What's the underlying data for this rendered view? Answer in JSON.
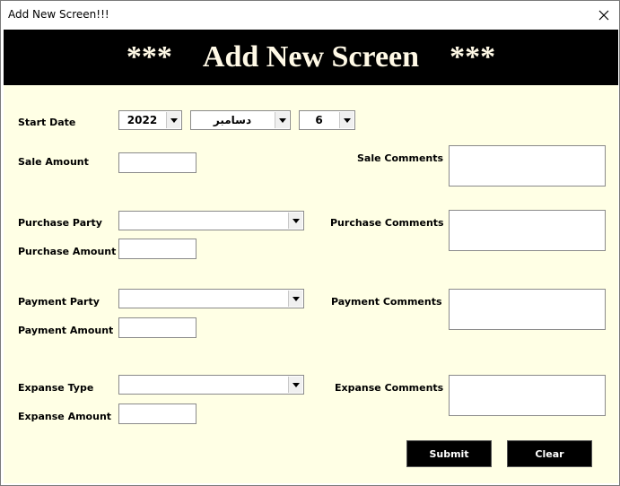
{
  "window": {
    "title": "Add New Screen!!!"
  },
  "banner": {
    "left_stars": "***",
    "heading": "Add New Screen",
    "right_stars": "***"
  },
  "form": {
    "start_date_label": "Start Date",
    "year": "2022",
    "month": "دسامبر",
    "day": "6",
    "sale_amount_label": "Sale Amount",
    "sale_comments_label": "Sale Comments",
    "purchase_party_label": "Purchase Party",
    "purchase_amount_label": "Purchase Amount",
    "purchase_comments_label": "Purchase Comments",
    "payment_party_label": "Payment Party",
    "payment_amount_label": "Payment Amount",
    "payment_comments_label": "Payment Comments",
    "expanse_type_label": "Expanse Type",
    "expanse_amount_label": "Expanse Amount",
    "expanse_comments_label": "Expanse Comments",
    "submit_label": "Submit",
    "clear_label": "Clear"
  },
  "colors": {
    "background": "#ffffe5",
    "banner": "#000000",
    "button": "#000000"
  },
  "icons": {
    "close": "close-icon",
    "dropdown": "chevron-down-icon"
  }
}
